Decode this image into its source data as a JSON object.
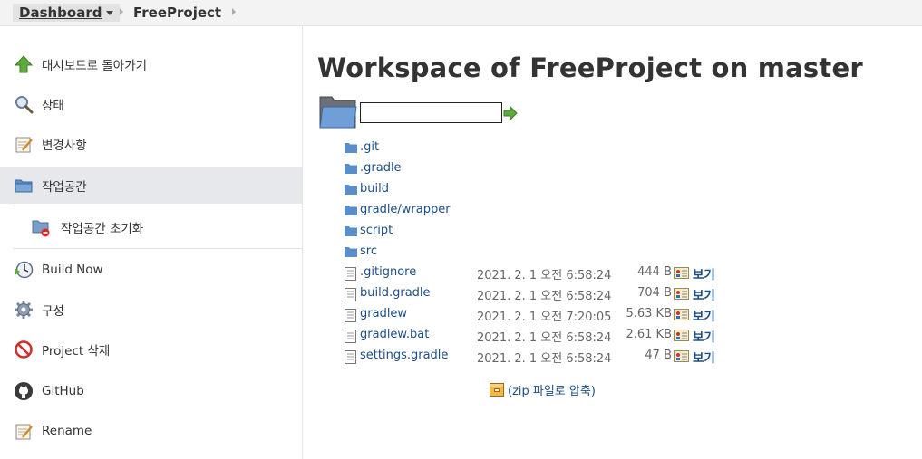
{
  "breadcrumb": {
    "items": [
      {
        "label": "Dashboard"
      },
      {
        "label": "FreeProject"
      }
    ]
  },
  "sidebar": {
    "items": [
      {
        "label": "대시보드로 돌아가기",
        "icon": "up-arrow-icon"
      },
      {
        "label": "상태",
        "icon": "search-icon"
      },
      {
        "label": "변경사항",
        "icon": "notepad-icon"
      },
      {
        "label": "작업공간",
        "icon": "folder-icon"
      },
      {
        "label": "작업공간 초기화",
        "icon": "wipe-workspace-icon"
      },
      {
        "label": "Build Now",
        "icon": "clock-icon"
      },
      {
        "label": "구성",
        "icon": "gear-icon"
      },
      {
        "label": "Project 삭제",
        "icon": "no-entry-icon"
      },
      {
        "label": "GitHub",
        "icon": "github-icon"
      },
      {
        "label": "Rename",
        "icon": "notepad-icon"
      }
    ]
  },
  "main": {
    "title": "Workspace of FreeProject on master",
    "path_input": {
      "value": ""
    },
    "folders": [
      {
        "name": ".git"
      },
      {
        "name": ".gradle"
      },
      {
        "name": "build"
      },
      {
        "name": "gradle/wrapper"
      },
      {
        "name": "script"
      },
      {
        "name": "src"
      }
    ],
    "files": [
      {
        "name": ".gitignore",
        "date": "2021. 2. 1 오전 6:58:24",
        "size": "444 B",
        "view": "보기"
      },
      {
        "name": "build.gradle",
        "date": "2021. 2. 1 오전 6:58:24",
        "size": "704 B",
        "view": "보기"
      },
      {
        "name": "gradlew",
        "date": "2021. 2. 1 오전 7:20:05",
        "size": "5.63 KB",
        "view": "보기"
      },
      {
        "name": "gradlew.bat",
        "date": "2021. 2. 1 오전 6:58:24",
        "size": "2.61 KB",
        "view": "보기"
      },
      {
        "name": "settings.gradle",
        "date": "2021. 2. 1 오전 6:58:24",
        "size": "47 B",
        "view": "보기"
      }
    ],
    "zip_label": "(zip 파일로 압축)"
  },
  "colors": {
    "link": "#1c4e87",
    "active_bg": "#e6e8ec",
    "folder": "#5b8ec9"
  }
}
